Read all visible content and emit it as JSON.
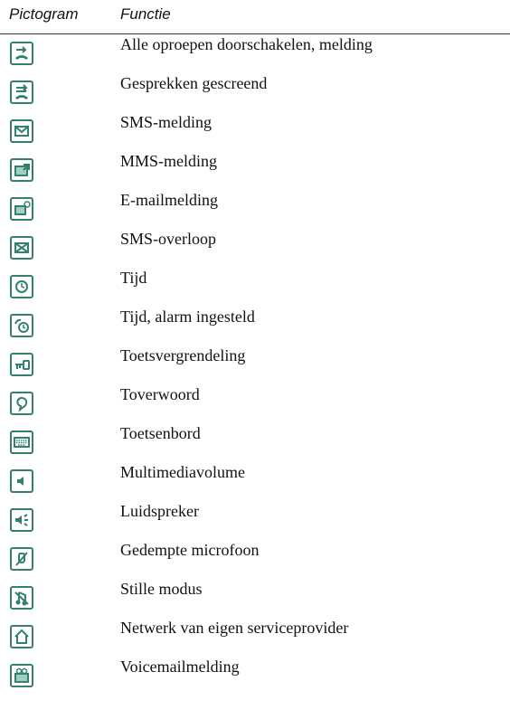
{
  "header": {
    "col_icon": "Pictogram",
    "col_function": "Functie"
  },
  "rows": [
    {
      "icon": "call-forward-icon",
      "label": "Alle oproepen doorschakelen, melding"
    },
    {
      "icon": "call-screened-icon",
      "label": "Gesprekken gescreend"
    },
    {
      "icon": "sms-icon",
      "label": "SMS-melding"
    },
    {
      "icon": "mms-icon",
      "label": "MMS-melding"
    },
    {
      "icon": "email-icon",
      "label": "E-mailmelding"
    },
    {
      "icon": "sms-overflow-icon",
      "label": "SMS-overloop"
    },
    {
      "icon": "clock-icon",
      "label": "Tijd"
    },
    {
      "icon": "alarm-clock-icon",
      "label": "Tijd, alarm ingesteld"
    },
    {
      "icon": "keylock-icon",
      "label": "Toetsvergrendeling"
    },
    {
      "icon": "magic-word-icon",
      "label": "Toverwoord"
    },
    {
      "icon": "keyboard-icon",
      "label": "Toetsenbord"
    },
    {
      "icon": "volume-icon",
      "label": "Multimediavolume"
    },
    {
      "icon": "speaker-icon",
      "label": "Luidspreker"
    },
    {
      "icon": "mic-muted-icon",
      "label": "Gedempte microfoon"
    },
    {
      "icon": "silent-mode-icon",
      "label": "Stille modus"
    },
    {
      "icon": "home-network-icon",
      "label": "Netwerk van eigen serviceprovider"
    },
    {
      "icon": "voicemail-icon",
      "label": "Voicemailmelding"
    }
  ],
  "colors": {
    "icon_border": "#33806f",
    "text": "#111111"
  }
}
